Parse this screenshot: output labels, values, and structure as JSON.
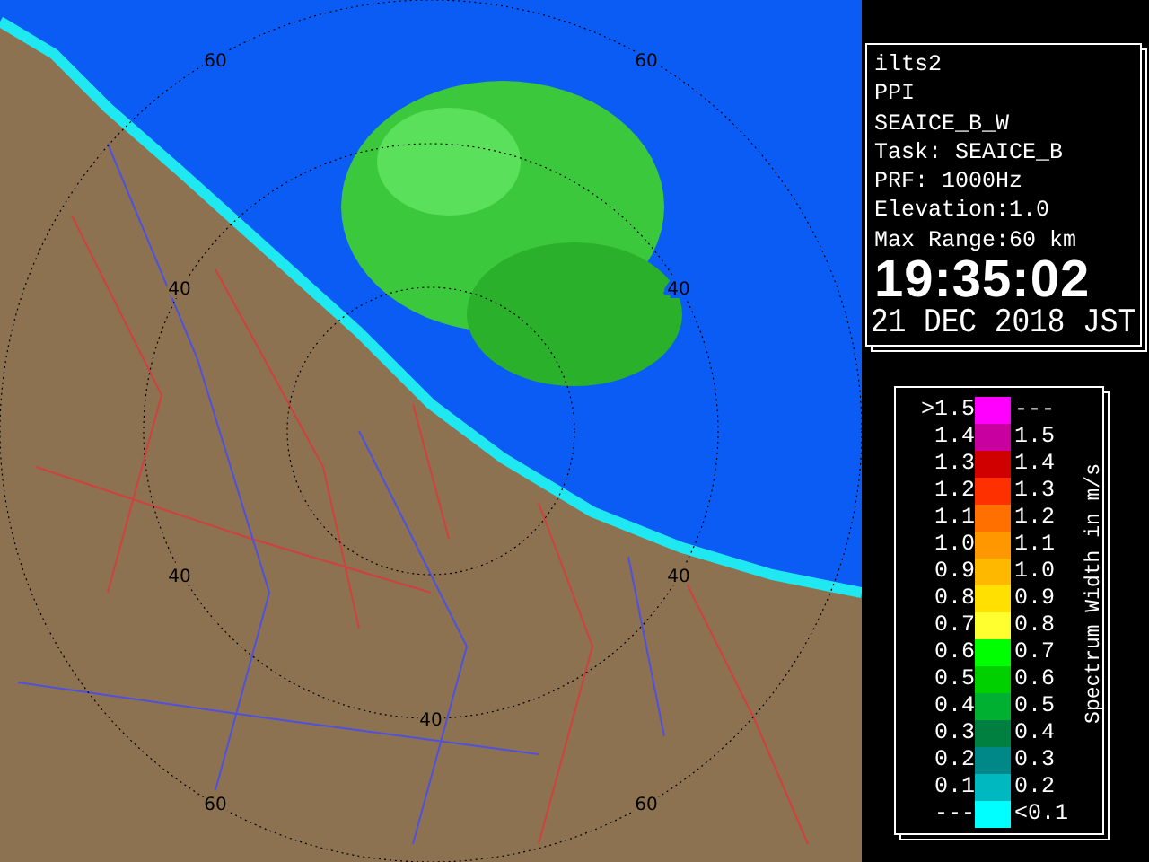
{
  "radar_map": {
    "range_labels": [
      "60",
      "60",
      "40",
      "40",
      "40",
      "40",
      "40",
      "60",
      "60"
    ]
  },
  "info_panel": {
    "lines": [
      "ilts2",
      "PPI",
      "SEAICE_B_W",
      "Task: SEAICE_B",
      "PRF: 1000Hz",
      "Elevation:1.0",
      "Max Range:60 km"
    ],
    "time": "19:35:02",
    "date": "21 DEC 2018 JST"
  },
  "legend": {
    "title": "Spectrum Width in m/s",
    "bins": [
      {
        "low": ">1.5",
        "high": "---",
        "color": "#ff00ff"
      },
      {
        "low": "1.4",
        "high": "1.5",
        "color": "#c800a0"
      },
      {
        "low": "1.3",
        "high": "1.4",
        "color": "#d00000"
      },
      {
        "low": "1.2",
        "high": "1.3",
        "color": "#ff3000"
      },
      {
        "low": "1.1",
        "high": "1.2",
        "color": "#ff7000"
      },
      {
        "low": "1.0",
        "high": "1.1",
        "color": "#ff9800"
      },
      {
        "low": "0.9",
        "high": "1.0",
        "color": "#ffb800"
      },
      {
        "low": "0.8",
        "high": "0.9",
        "color": "#ffe000"
      },
      {
        "low": "0.7",
        "high": "0.8",
        "color": "#ffff30"
      },
      {
        "low": "0.6",
        "high": "0.7",
        "color": "#00ff00"
      },
      {
        "low": "0.5",
        "high": "0.6",
        "color": "#00d000"
      },
      {
        "low": "0.4",
        "high": "0.5",
        "color": "#00b030"
      },
      {
        "low": "0.3",
        "high": "0.4",
        "color": "#008040"
      },
      {
        "low": "0.2",
        "high": "0.3",
        "color": "#008888"
      },
      {
        "low": "0.1",
        "high": "0.2",
        "color": "#00b8c0"
      },
      {
        "low": "---",
        "high": "<0.1",
        "color": "#00ffff"
      }
    ]
  }
}
